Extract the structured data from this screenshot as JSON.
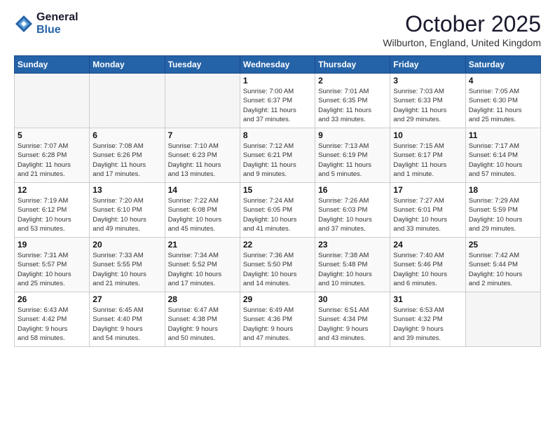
{
  "header": {
    "logo_general": "General",
    "logo_blue": "Blue",
    "month_title": "October 2025",
    "location": "Wilburton, England, United Kingdom"
  },
  "days_of_week": [
    "Sunday",
    "Monday",
    "Tuesday",
    "Wednesday",
    "Thursday",
    "Friday",
    "Saturday"
  ],
  "weeks": [
    [
      {
        "day": "",
        "info": ""
      },
      {
        "day": "",
        "info": ""
      },
      {
        "day": "",
        "info": ""
      },
      {
        "day": "1",
        "info": "Sunrise: 7:00 AM\nSunset: 6:37 PM\nDaylight: 11 hours\nand 37 minutes."
      },
      {
        "day": "2",
        "info": "Sunrise: 7:01 AM\nSunset: 6:35 PM\nDaylight: 11 hours\nand 33 minutes."
      },
      {
        "day": "3",
        "info": "Sunrise: 7:03 AM\nSunset: 6:33 PM\nDaylight: 11 hours\nand 29 minutes."
      },
      {
        "day": "4",
        "info": "Sunrise: 7:05 AM\nSunset: 6:30 PM\nDaylight: 11 hours\nand 25 minutes."
      }
    ],
    [
      {
        "day": "5",
        "info": "Sunrise: 7:07 AM\nSunset: 6:28 PM\nDaylight: 11 hours\nand 21 minutes."
      },
      {
        "day": "6",
        "info": "Sunrise: 7:08 AM\nSunset: 6:26 PM\nDaylight: 11 hours\nand 17 minutes."
      },
      {
        "day": "7",
        "info": "Sunrise: 7:10 AM\nSunset: 6:23 PM\nDaylight: 11 hours\nand 13 minutes."
      },
      {
        "day": "8",
        "info": "Sunrise: 7:12 AM\nSunset: 6:21 PM\nDaylight: 11 hours\nand 9 minutes."
      },
      {
        "day": "9",
        "info": "Sunrise: 7:13 AM\nSunset: 6:19 PM\nDaylight: 11 hours\nand 5 minutes."
      },
      {
        "day": "10",
        "info": "Sunrise: 7:15 AM\nSunset: 6:17 PM\nDaylight: 11 hours\nand 1 minute."
      },
      {
        "day": "11",
        "info": "Sunrise: 7:17 AM\nSunset: 6:14 PM\nDaylight: 10 hours\nand 57 minutes."
      }
    ],
    [
      {
        "day": "12",
        "info": "Sunrise: 7:19 AM\nSunset: 6:12 PM\nDaylight: 10 hours\nand 53 minutes."
      },
      {
        "day": "13",
        "info": "Sunrise: 7:20 AM\nSunset: 6:10 PM\nDaylight: 10 hours\nand 49 minutes."
      },
      {
        "day": "14",
        "info": "Sunrise: 7:22 AM\nSunset: 6:08 PM\nDaylight: 10 hours\nand 45 minutes."
      },
      {
        "day": "15",
        "info": "Sunrise: 7:24 AM\nSunset: 6:05 PM\nDaylight: 10 hours\nand 41 minutes."
      },
      {
        "day": "16",
        "info": "Sunrise: 7:26 AM\nSunset: 6:03 PM\nDaylight: 10 hours\nand 37 minutes."
      },
      {
        "day": "17",
        "info": "Sunrise: 7:27 AM\nSunset: 6:01 PM\nDaylight: 10 hours\nand 33 minutes."
      },
      {
        "day": "18",
        "info": "Sunrise: 7:29 AM\nSunset: 5:59 PM\nDaylight: 10 hours\nand 29 minutes."
      }
    ],
    [
      {
        "day": "19",
        "info": "Sunrise: 7:31 AM\nSunset: 5:57 PM\nDaylight: 10 hours\nand 25 minutes."
      },
      {
        "day": "20",
        "info": "Sunrise: 7:33 AM\nSunset: 5:55 PM\nDaylight: 10 hours\nand 21 minutes."
      },
      {
        "day": "21",
        "info": "Sunrise: 7:34 AM\nSunset: 5:52 PM\nDaylight: 10 hours\nand 17 minutes."
      },
      {
        "day": "22",
        "info": "Sunrise: 7:36 AM\nSunset: 5:50 PM\nDaylight: 10 hours\nand 14 minutes."
      },
      {
        "day": "23",
        "info": "Sunrise: 7:38 AM\nSunset: 5:48 PM\nDaylight: 10 hours\nand 10 minutes."
      },
      {
        "day": "24",
        "info": "Sunrise: 7:40 AM\nSunset: 5:46 PM\nDaylight: 10 hours\nand 6 minutes."
      },
      {
        "day": "25",
        "info": "Sunrise: 7:42 AM\nSunset: 5:44 PM\nDaylight: 10 hours\nand 2 minutes."
      }
    ],
    [
      {
        "day": "26",
        "info": "Sunrise: 6:43 AM\nSunset: 4:42 PM\nDaylight: 9 hours\nand 58 minutes."
      },
      {
        "day": "27",
        "info": "Sunrise: 6:45 AM\nSunset: 4:40 PM\nDaylight: 9 hours\nand 54 minutes."
      },
      {
        "day": "28",
        "info": "Sunrise: 6:47 AM\nSunset: 4:38 PM\nDaylight: 9 hours\nand 50 minutes."
      },
      {
        "day": "29",
        "info": "Sunrise: 6:49 AM\nSunset: 4:36 PM\nDaylight: 9 hours\nand 47 minutes."
      },
      {
        "day": "30",
        "info": "Sunrise: 6:51 AM\nSunset: 4:34 PM\nDaylight: 9 hours\nand 43 minutes."
      },
      {
        "day": "31",
        "info": "Sunrise: 6:53 AM\nSunset: 4:32 PM\nDaylight: 9 hours\nand 39 minutes."
      },
      {
        "day": "",
        "info": ""
      }
    ]
  ]
}
